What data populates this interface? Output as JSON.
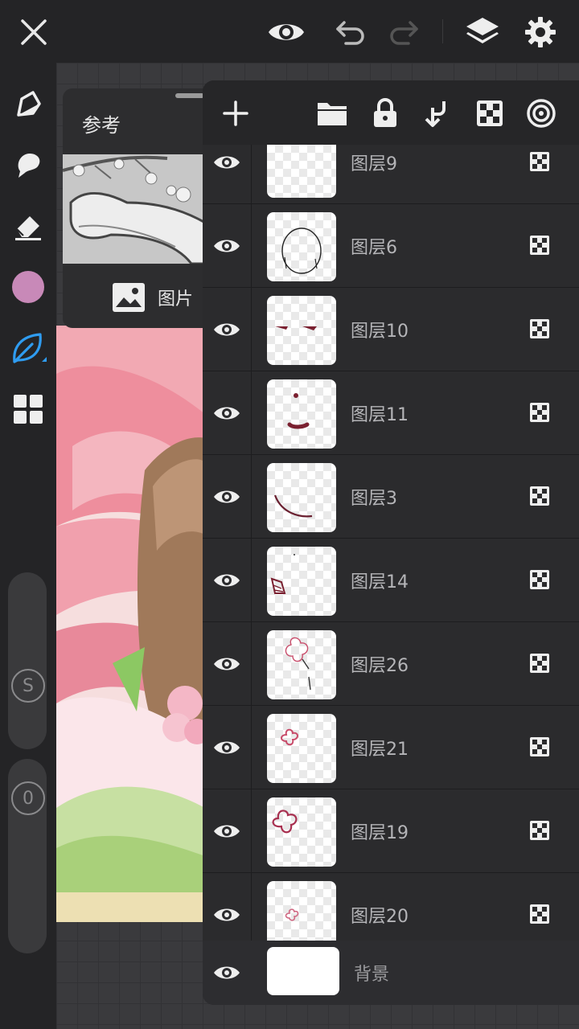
{
  "topbar": {
    "close_icon": "close-icon",
    "preview_icon": "eye-icon",
    "undo_icon": "undo-icon",
    "redo_icon": "redo-icon",
    "layers_icon": "layers-icon",
    "settings_icon": "gear-icon"
  },
  "toolbar": {
    "tools": [
      "pen-tool-icon",
      "smudge-icon",
      "eraser-icon",
      "color-swatch",
      "leaf-brush-icon",
      "gallery-grid-icon"
    ],
    "current_color": "#c889b8",
    "active_tool_color": "#2f9cf0",
    "size_slider_label": "S",
    "opacity_slider_label": "0"
  },
  "reference": {
    "title": "参考",
    "type_label": "图片"
  },
  "layers_toolbar": {
    "buttons": [
      "add-layer-icon",
      "folder-icon",
      "lock-icon",
      "merge-down-icon",
      "alpha-lock-icon",
      "blend-icon"
    ]
  },
  "layers": [
    {
      "name": "图层9"
    },
    {
      "name": "图层6"
    },
    {
      "name": "图层10"
    },
    {
      "name": "图层11"
    },
    {
      "name": "图层3"
    },
    {
      "name": "图层14"
    },
    {
      "name": "图层26"
    },
    {
      "name": "图层21"
    },
    {
      "name": "图层19"
    },
    {
      "name": "图层20"
    }
  ],
  "background_layer": {
    "name": "背景",
    "color": "#ffffff"
  }
}
